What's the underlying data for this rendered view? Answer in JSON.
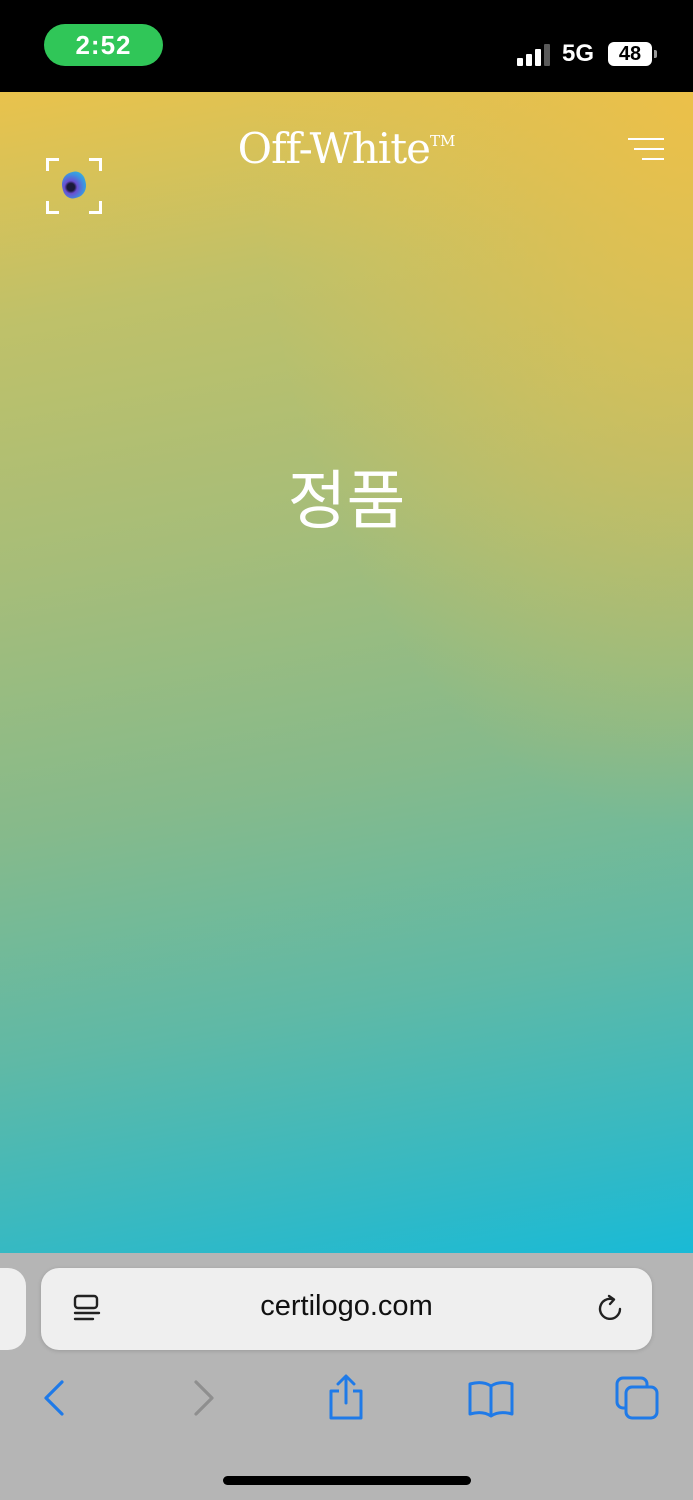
{
  "status_bar": {
    "time": "2:52",
    "network": "5G",
    "battery": "48",
    "signal_bars": 3,
    "time_pill_color": "#30c658"
  },
  "page": {
    "brand": "Off-White",
    "brand_tm": "TM",
    "result": "정품",
    "scan_icon": "scan-frame-icon",
    "menu_icon": "hamburger-menu-icon"
  },
  "browser": {
    "url": "certilogo.com",
    "reader_icon": "page-menu-icon",
    "reload_icon": "reload-icon",
    "toolbar_icons": [
      "back-icon",
      "forward-icon",
      "share-icon",
      "bookmarks-icon",
      "tabs-icon"
    ],
    "accent_color": "#1f7ae8"
  }
}
